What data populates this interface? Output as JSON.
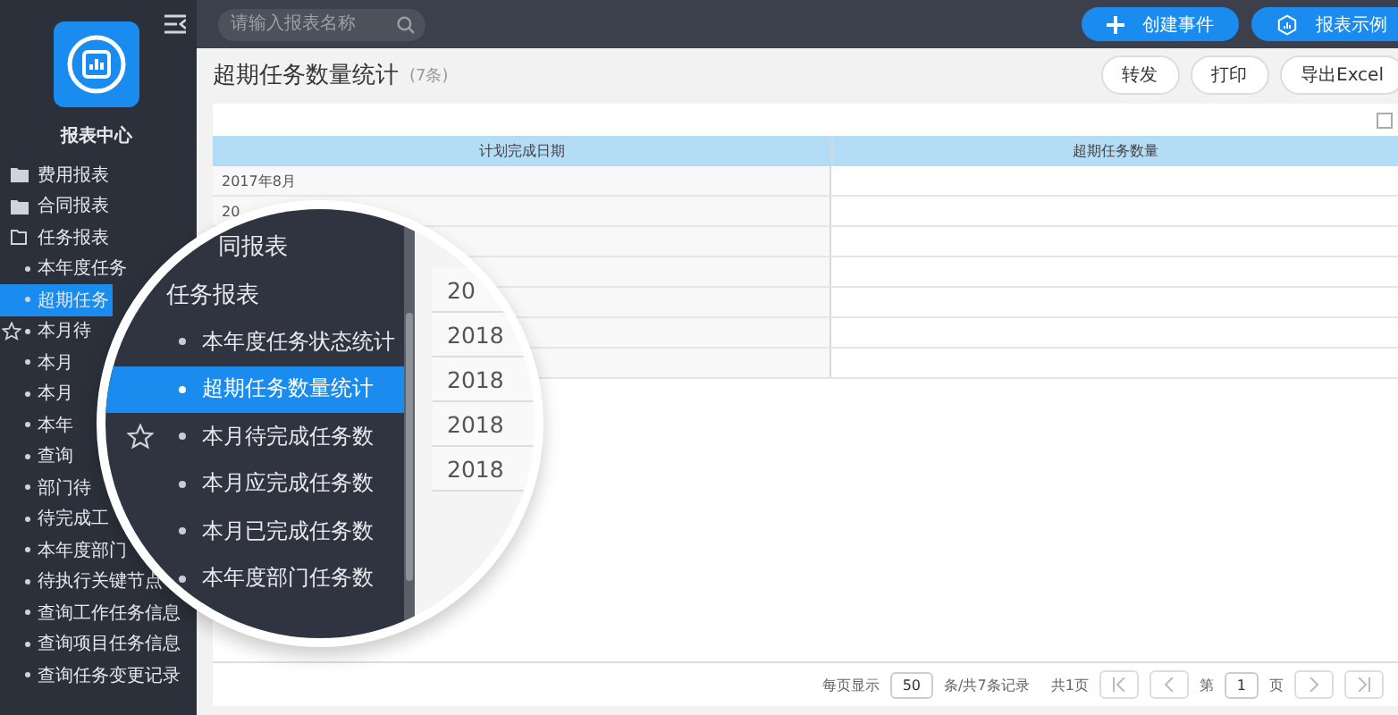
{
  "sidebar": {
    "app_name": "报表中心",
    "groups": [
      {
        "label": "费用报表",
        "expanded": false
      },
      {
        "label": "合同报表",
        "expanded": false
      },
      {
        "label": "任务报表",
        "expanded": true,
        "children": [
          {
            "label": "本年度任务",
            "selected": false,
            "starred": false
          },
          {
            "label": "超期任务",
            "selected": true,
            "starred": false
          },
          {
            "label": "本月待",
            "selected": false,
            "starred": true
          },
          {
            "label": "本月",
            "selected": false,
            "starred": false
          },
          {
            "label": "本月",
            "selected": false,
            "starred": false
          },
          {
            "label": "本年",
            "selected": false,
            "starred": false
          },
          {
            "label": "查询",
            "selected": false,
            "starred": false
          },
          {
            "label": "部门待",
            "selected": false,
            "starred": false
          },
          {
            "label": "待完成工",
            "selected": false,
            "starred": false
          },
          {
            "label": "本年度部门",
            "selected": false,
            "starred": false
          },
          {
            "label": "待执行关键节点",
            "selected": false,
            "starred": false
          },
          {
            "label": "查询工作任务信息",
            "selected": false,
            "starred": false
          },
          {
            "label": "查询项目任务信息",
            "selected": false,
            "starred": false
          },
          {
            "label": "查询任务变更记录",
            "selected": false,
            "starred": false
          }
        ]
      }
    ]
  },
  "topbar": {
    "search": {
      "placeholder": "请输入报表名称"
    },
    "buttons": [
      "创建事件",
      "报表示例"
    ]
  },
  "page": {
    "title": "超期任务数量统计",
    "count": "(7条)",
    "actions": [
      "转发",
      "打印",
      "导出Excel"
    ]
  },
  "table": {
    "columns": [
      "计划完成日期",
      "超期任务数量"
    ],
    "rows": [
      {
        "column_1": "2017年8月"
      },
      {
        "column_1": "20"
      },
      {},
      {},
      {},
      {},
      {}
    ]
  },
  "pagination": {
    "per_page_label": "每页显示",
    "per_page": "50",
    "records": "条/共7条记录",
    "pages": "共1页",
    "page_prefix": "第",
    "page": "1",
    "page_suffix": "页"
  },
  "magnifier": {
    "items": [
      {
        "label": "同报表",
        "kind": "group",
        "selected": false,
        "starred": false
      },
      {
        "label": "任务报表",
        "kind": "group",
        "selected": false,
        "starred": false
      },
      {
        "label": "本年度任务状态统计",
        "kind": "item",
        "selected": false,
        "starred": false
      },
      {
        "label": "超期任务数量统计",
        "kind": "item",
        "selected": true,
        "starred": false
      },
      {
        "label": "本月待完成任务数",
        "kind": "item",
        "selected": false,
        "starred": true
      },
      {
        "label": "本月应完成任务数",
        "kind": "item",
        "selected": false,
        "starred": false
      },
      {
        "label": "本月已完成任务数",
        "kind": "item",
        "selected": false,
        "starred": false
      },
      {
        "label": "本年度部门任务数",
        "kind": "item",
        "selected": false,
        "starred": false
      }
    ],
    "cells": [
      "20",
      "2018",
      "2018",
      "2018",
      "2018"
    ]
  }
}
